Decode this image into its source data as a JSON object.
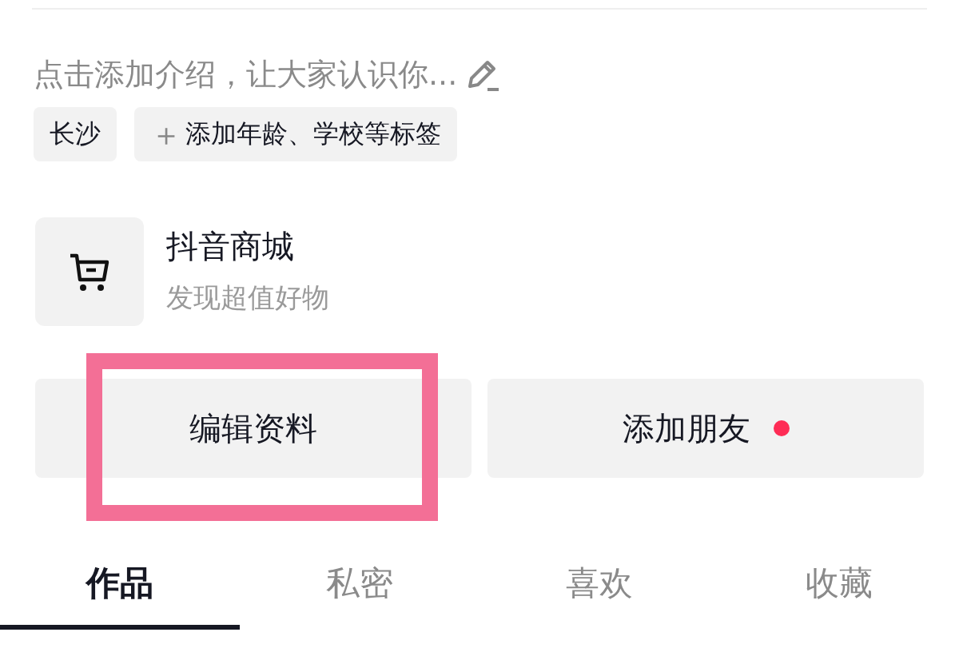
{
  "bio": {
    "placeholder": "点击添加介绍，让大家认识你..."
  },
  "tags": [
    {
      "kind": "location",
      "label": "长沙"
    },
    {
      "kind": "add",
      "icon": "＋",
      "label": "添加年龄、学校等标签"
    }
  ],
  "shop": {
    "title": "抖音商城",
    "subtitle": "发现超值好物"
  },
  "buttons": [
    {
      "label": "编辑资料",
      "highlighted": true,
      "badge": false
    },
    {
      "label": "添加朋友",
      "highlighted": false,
      "badge": true
    }
  ],
  "tabs": [
    {
      "label": "作品",
      "selected": true
    },
    {
      "label": "私密",
      "selected": false
    },
    {
      "label": "喜欢",
      "selected": false
    },
    {
      "label": "收藏",
      "selected": false
    }
  ]
}
